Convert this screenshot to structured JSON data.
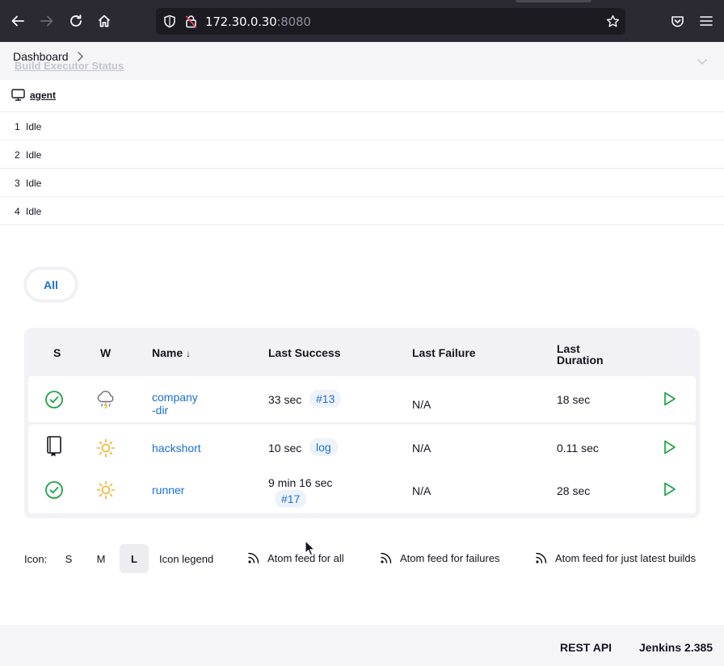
{
  "browser": {
    "url_host": "172.30.0.30",
    "url_port": ":8080"
  },
  "breadcrumb": {
    "dashboard": "Dashboard",
    "section_title": "Build Executor Status"
  },
  "executors": {
    "agent_name": "agent",
    "rows": [
      {
        "num": "1",
        "status": "Idle"
      },
      {
        "num": "2",
        "status": "Idle"
      },
      {
        "num": "3",
        "status": "Idle"
      },
      {
        "num": "4",
        "status": "Idle"
      }
    ]
  },
  "view_tabs": {
    "all": "All"
  },
  "table": {
    "headers": {
      "s": "S",
      "w": "W",
      "name": "Name",
      "name_sort": "↓",
      "last_success": "Last Success",
      "last_failure": "Last Failure",
      "last_duration_1": "Last",
      "last_duration_2": "Duration"
    },
    "rows": [
      {
        "status_icon": "success-check-icon",
        "weather_icon": "thunderstorm-icon",
        "name_line1": "company",
        "name_line2": "-dir",
        "last_success": "33 sec",
        "success_badge": "#13",
        "last_failure": "N/A",
        "duration": "18 sec"
      },
      {
        "status_icon": "not-built-notebook-icon",
        "weather_icon": "sunny-icon",
        "name_line1": "hackshort",
        "last_success": "10 sec",
        "success_badge": "log",
        "last_failure": "N/A",
        "duration": "0.11 sec"
      },
      {
        "status_icon": "success-check-icon",
        "weather_icon": "sunny-icon",
        "name_line1": "runner",
        "last_success": "9 min 16 sec",
        "success_badge": "#17",
        "last_failure": "N/A",
        "duration": "28 sec"
      }
    ]
  },
  "legend": {
    "icon_label": "Icon:",
    "size_s": "S",
    "size_m": "M",
    "size_l": "L",
    "icon_legend": "Icon legend",
    "feed_all": "Atom feed for all",
    "feed_failures": "Atom feed for failures",
    "feed_latest": "Atom feed for just latest builds"
  },
  "footer": {
    "rest_api": "REST API",
    "version": "Jenkins 2.385"
  },
  "colors": {
    "link": "#1c6fd4",
    "success": "#1ea446",
    "sun": "#f2b327",
    "toolbar": "#2b2a33"
  }
}
